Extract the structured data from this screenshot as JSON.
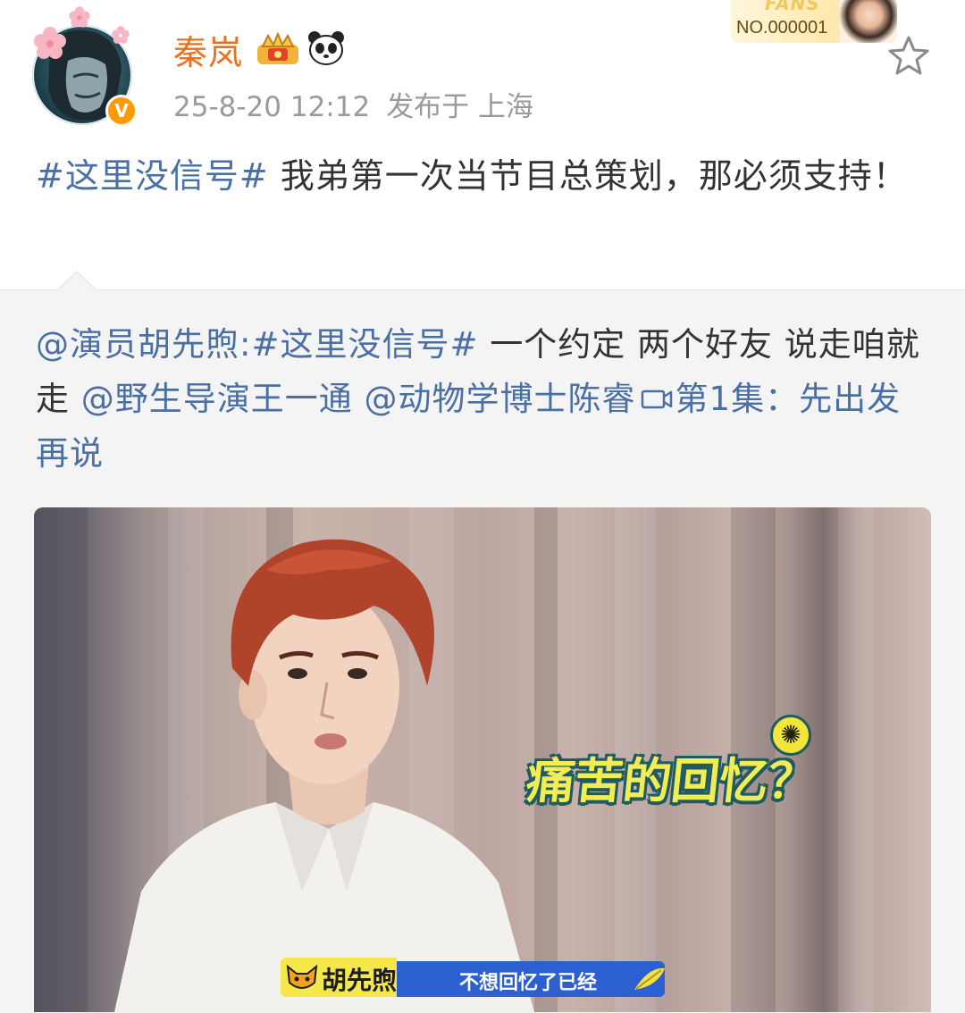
{
  "author": {
    "name": "秦岚",
    "timestamp": "25-8-20 12:12",
    "location": "发布于 上海",
    "verified_badge": "V",
    "badges": [
      "crown-icon",
      "panda-icon"
    ]
  },
  "fans_card": {
    "word": "FANS",
    "number": "NO.000001"
  },
  "post": {
    "hashtag": "#这里没信号#",
    "text": " 我弟第一次当节目总策划，那必须支持！"
  },
  "repost": {
    "mention": "@演员胡先煦",
    "separator": ":",
    "hashtag": "#这里没信号#",
    "text1": " 一个约定 两个好友 说走咱就走 ",
    "mention2": "@野生导演王一通",
    "space": " ",
    "mention3": "@动物学博士陈睿",
    "video_link": "第1集：先出发再说"
  },
  "video": {
    "caption": "痛苦的回忆？",
    "name_tag": "胡先煦",
    "subtitle": "不想回忆了已经"
  },
  "colors": {
    "username": "#e8701f",
    "link": "#4a6fa5",
    "meta": "#9a9a9a",
    "repost_bg": "#f4f4f4",
    "caption_yellow": "#f2ec55",
    "subtitle_blue": "#2c5fd0"
  }
}
